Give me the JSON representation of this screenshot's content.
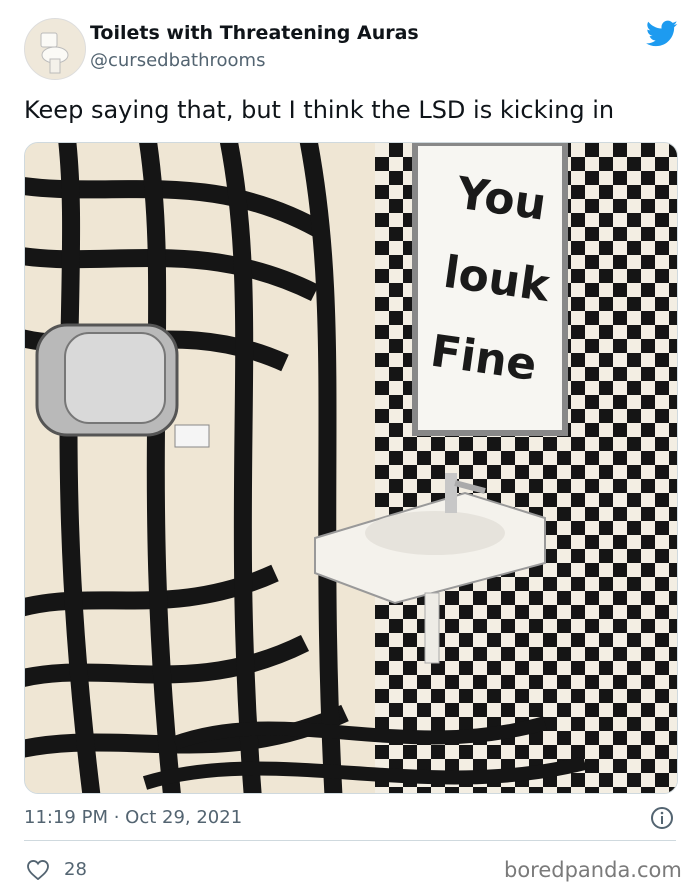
{
  "tweet": {
    "author_name": "Toilets with Threatening Auras",
    "author_handle": "@cursedbathrooms",
    "text": "Keep saying that, but I think the LSD is kicking in",
    "timestamp": "11:19 PM · Oct 29, 2021",
    "like_count": "28"
  },
  "media": {
    "mirror_text_line1": "You",
    "mirror_text_line2": "louk",
    "mirror_text_line3": "Fine"
  },
  "watermark": "boredpanda.com",
  "icons": {
    "platform": "twitter-bird-icon",
    "info": "info-icon",
    "like": "heart-icon"
  },
  "colors": {
    "brand": "#1d9bf0",
    "text": "#0f1419",
    "secondary": "#536471"
  }
}
